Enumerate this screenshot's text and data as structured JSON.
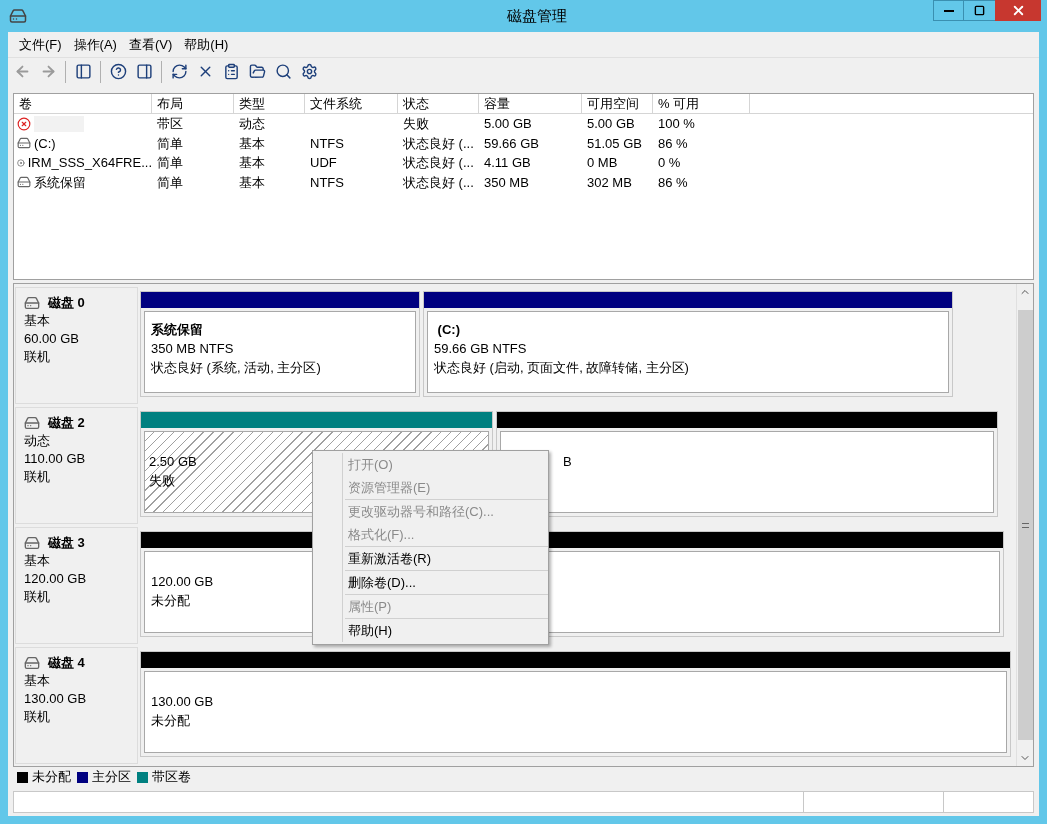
{
  "window": {
    "title": "磁盘管理"
  },
  "menu_bar": [
    "文件(F)",
    "操作(A)",
    "查看(V)",
    "帮助(H)"
  ],
  "toolbar": [
    {
      "kind": "back",
      "disabled": true
    },
    {
      "kind": "forward",
      "disabled": true
    },
    {
      "kind": "sep"
    },
    {
      "kind": "tree",
      "disabled": false
    },
    {
      "kind": "sep"
    },
    {
      "kind": "help",
      "disabled": false
    },
    {
      "kind": "pane",
      "disabled": false
    },
    {
      "kind": "sep"
    },
    {
      "kind": "refresh",
      "disabled": false
    },
    {
      "kind": "delete",
      "disabled": false
    },
    {
      "kind": "properties",
      "disabled": false
    },
    {
      "kind": "open",
      "disabled": false
    },
    {
      "kind": "explore",
      "disabled": false
    },
    {
      "kind": "settings",
      "disabled": false
    }
  ],
  "volume_table": {
    "columns": [
      "卷",
      "布局",
      "类型",
      "文件系统",
      "状态",
      "容量",
      "可用空间",
      "% 可用"
    ],
    "rows": [
      {
        "kind": "failed",
        "cells": [
          "",
          "带区",
          "动态",
          "",
          "失败",
          "5.00 GB",
          "5.00 GB",
          "100 %"
        ]
      },
      {
        "kind": "drive",
        "cells": [
          "(C:)",
          "简单",
          "基本",
          "NTFS",
          "状态良好 (...",
          "59.66 GB",
          "51.05 GB",
          "86 %"
        ]
      },
      {
        "kind": "disc",
        "cells": [
          "IRM_SSS_X64FRE...",
          "简单",
          "基本",
          "UDF",
          "状态良好 (...",
          "4.11 GB",
          "0 MB",
          "0 %"
        ]
      },
      {
        "kind": "drive",
        "cells": [
          "系统保留",
          "简单",
          "基本",
          "NTFS",
          "状态良好 (...",
          "350 MB",
          "302 MB",
          "86 %"
        ]
      }
    ]
  },
  "disks": [
    {
      "name": "磁盘 0",
      "type": "基本",
      "size": "60.00 GB",
      "status": "联机",
      "partitions": [
        {
          "kind": "primary",
          "lines": [
            "系统保留",
            "350 MB NTFS",
            "状态良好 (系统, 活动, 主分区)"
          ]
        },
        {
          "kind": "primary",
          "lines": [
            " (C:)",
            "59.66 GB NTFS",
            "状态良好 (启动, 页面文件, 故障转储, 主分区)"
          ]
        }
      ]
    },
    {
      "name": "磁盘 2",
      "type": "动态",
      "size": "110.00 GB",
      "status": "联机",
      "partitions": [
        {
          "kind": "striped_failed",
          "lines": [
            "2.50 GB",
            "失败"
          ]
        },
        {
          "kind": "unallocated_covered",
          "lines": [
            "B"
          ]
        }
      ]
    },
    {
      "name": "磁盘 3",
      "type": "基本",
      "size": "120.00 GB",
      "status": "联机",
      "partitions": [
        {
          "kind": "unallocated",
          "lines": [
            "120.00 GB",
            "未分配"
          ]
        }
      ]
    },
    {
      "name": "磁盘 4",
      "type": "基本",
      "size": "130.00 GB",
      "status": "联机",
      "partitions": [
        {
          "kind": "unallocated",
          "lines": [
            "130.00 GB",
            "未分配"
          ]
        }
      ]
    }
  ],
  "legend": [
    {
      "label": "未分配",
      "color": "#000000"
    },
    {
      "label": "主分区",
      "color": "#000080"
    },
    {
      "label": "带区卷",
      "color": "#008080"
    }
  ],
  "context_menu": [
    [
      {
        "label": "打开(O)",
        "disabled": true
      },
      {
        "label": "资源管理器(E)",
        "disabled": true
      }
    ],
    [
      {
        "label": "更改驱动器号和路径(C)...",
        "disabled": true
      },
      {
        "label": "格式化(F)...",
        "disabled": true
      }
    ],
    [
      {
        "label": "重新激活卷(R)",
        "disabled": false
      }
    ],
    [
      {
        "label": "删除卷(D)...",
        "disabled": false
      }
    ],
    [
      {
        "label": "属性(P)",
        "disabled": true
      }
    ],
    [
      {
        "label": "帮助(H)",
        "disabled": false
      }
    ]
  ]
}
